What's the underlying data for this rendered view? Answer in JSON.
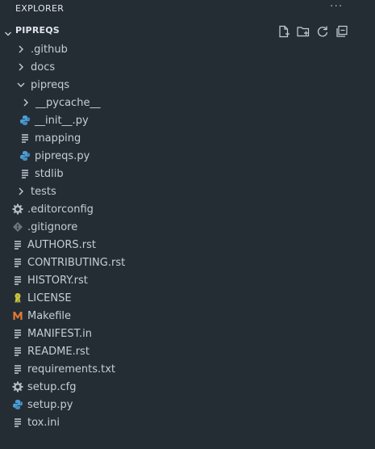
{
  "header": {
    "title": "EXPLORER",
    "more": "···"
  },
  "section": {
    "title": "PIPREQS"
  },
  "actions": [
    "new-file",
    "new-folder",
    "refresh",
    "collapse-all"
  ],
  "items": [
    {
      "label": ".github",
      "icon": "chevron-right-icon"
    },
    {
      "label": "docs",
      "icon": "chevron-right-icon"
    },
    {
      "label": "pipreqs",
      "icon": "chevron-down-icon"
    },
    {
      "label": "__pycache__",
      "icon": "chevron-right-icon"
    },
    {
      "label": "__init__.py",
      "icon": "python-icon"
    },
    {
      "label": "mapping",
      "icon": "text-file-icon"
    },
    {
      "label": "pipreqs.py",
      "icon": "python-icon"
    },
    {
      "label": "stdlib",
      "icon": "text-file-icon"
    },
    {
      "label": "tests",
      "icon": "chevron-right-icon"
    },
    {
      "label": ".editorconfig",
      "icon": "gear-icon"
    },
    {
      "label": ".gitignore",
      "icon": "git-icon"
    },
    {
      "label": "AUTHORS.rst",
      "icon": "text-file-icon"
    },
    {
      "label": "CONTRIBUTING.rst",
      "icon": "text-file-icon"
    },
    {
      "label": "HISTORY.rst",
      "icon": "text-file-icon"
    },
    {
      "label": "LICENSE",
      "icon": "license-icon"
    },
    {
      "label": "Makefile",
      "icon": "makefile-icon"
    },
    {
      "label": "MANIFEST.in",
      "icon": "text-file-icon"
    },
    {
      "label": "README.rst",
      "icon": "text-file-icon"
    },
    {
      "label": "requirements.txt",
      "icon": "text-file-icon"
    },
    {
      "label": "setup.cfg",
      "icon": "gear-icon"
    },
    {
      "label": "setup.py",
      "icon": "python-icon"
    },
    {
      "label": "tox.ini",
      "icon": "text-file-icon"
    }
  ],
  "colors": {
    "background": "#252d34",
    "text": "#c5cdd6",
    "python": "#4b9fd8",
    "makefile": "#e37933",
    "license": "#cbcb41",
    "git": "#6b7580"
  }
}
